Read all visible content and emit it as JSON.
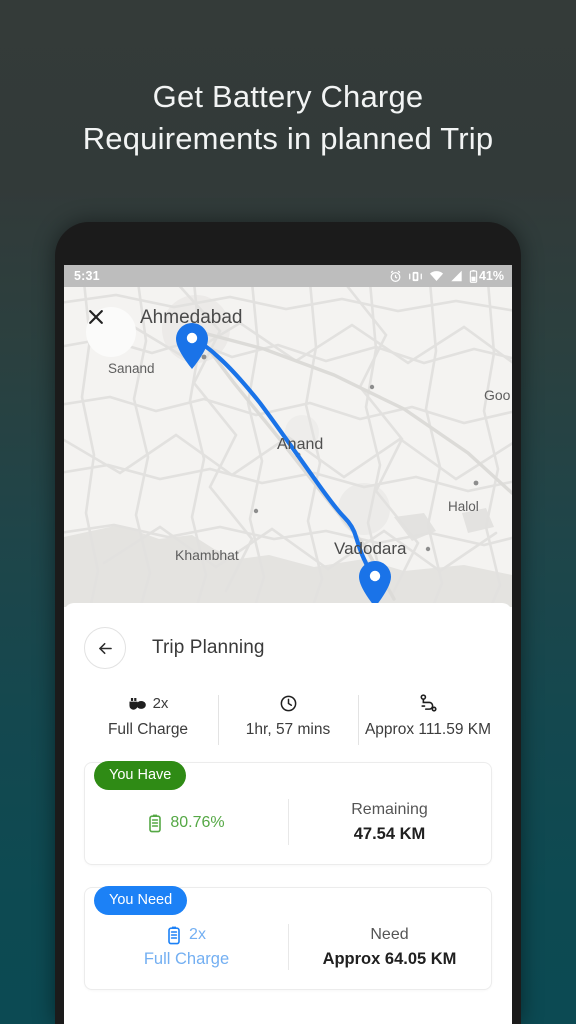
{
  "headline": {
    "line1": "Get Battery Charge",
    "line2": "Requirements in planned Trip"
  },
  "colors": {
    "background_top": "#343b39",
    "background_bottom": "#0c4a53",
    "phone_frame": "#1b1b1b",
    "badge_green": "#2f8b15",
    "badge_blue": "#1c81f6",
    "route_blue": "#1a73e8",
    "status_bar": "#bdbdbd"
  },
  "status_bar": {
    "time": "5:31",
    "battery_percent": "41%",
    "icons": [
      "alarm-icon",
      "vibrate-icon",
      "wifi-icon",
      "signal-icon",
      "battery-icon"
    ]
  },
  "map": {
    "close_icon": "close-icon",
    "labels": {
      "ahmedabad": "Ahmedabad",
      "sanand": "Sanand",
      "anand": "Anand",
      "halol": "Halol",
      "vadodara": "Vadodara",
      "khambhat": "Khambhat",
      "godhra": "Goo"
    },
    "origin_marker": "map-pin-origin",
    "destination_marker": "map-pin-destination"
  },
  "sheet": {
    "back_icon": "arrow-left-icon",
    "title": "Trip Planning",
    "stats": [
      {
        "icon": "charging-plug-icon",
        "value": "2x",
        "text": "Full Charge"
      },
      {
        "icon": "clock-icon",
        "value": "",
        "text": "1hr, 57 mins"
      },
      {
        "icon": "route-icon",
        "value": "",
        "text": "Approx 111.59 KM"
      }
    ],
    "cards": [
      {
        "badge": "You Have",
        "left_icon": "battery-icon",
        "left_line1": "80.76%",
        "left_line2": "",
        "right_line1": "Remaining",
        "right_line2": "47.54 KM"
      },
      {
        "badge": "You Need",
        "left_icon": "battery-icon",
        "left_line1": "2x",
        "left_line2": "Full Charge",
        "right_line1": "Need",
        "right_line2": "Approx 64.05 KM"
      }
    ]
  }
}
